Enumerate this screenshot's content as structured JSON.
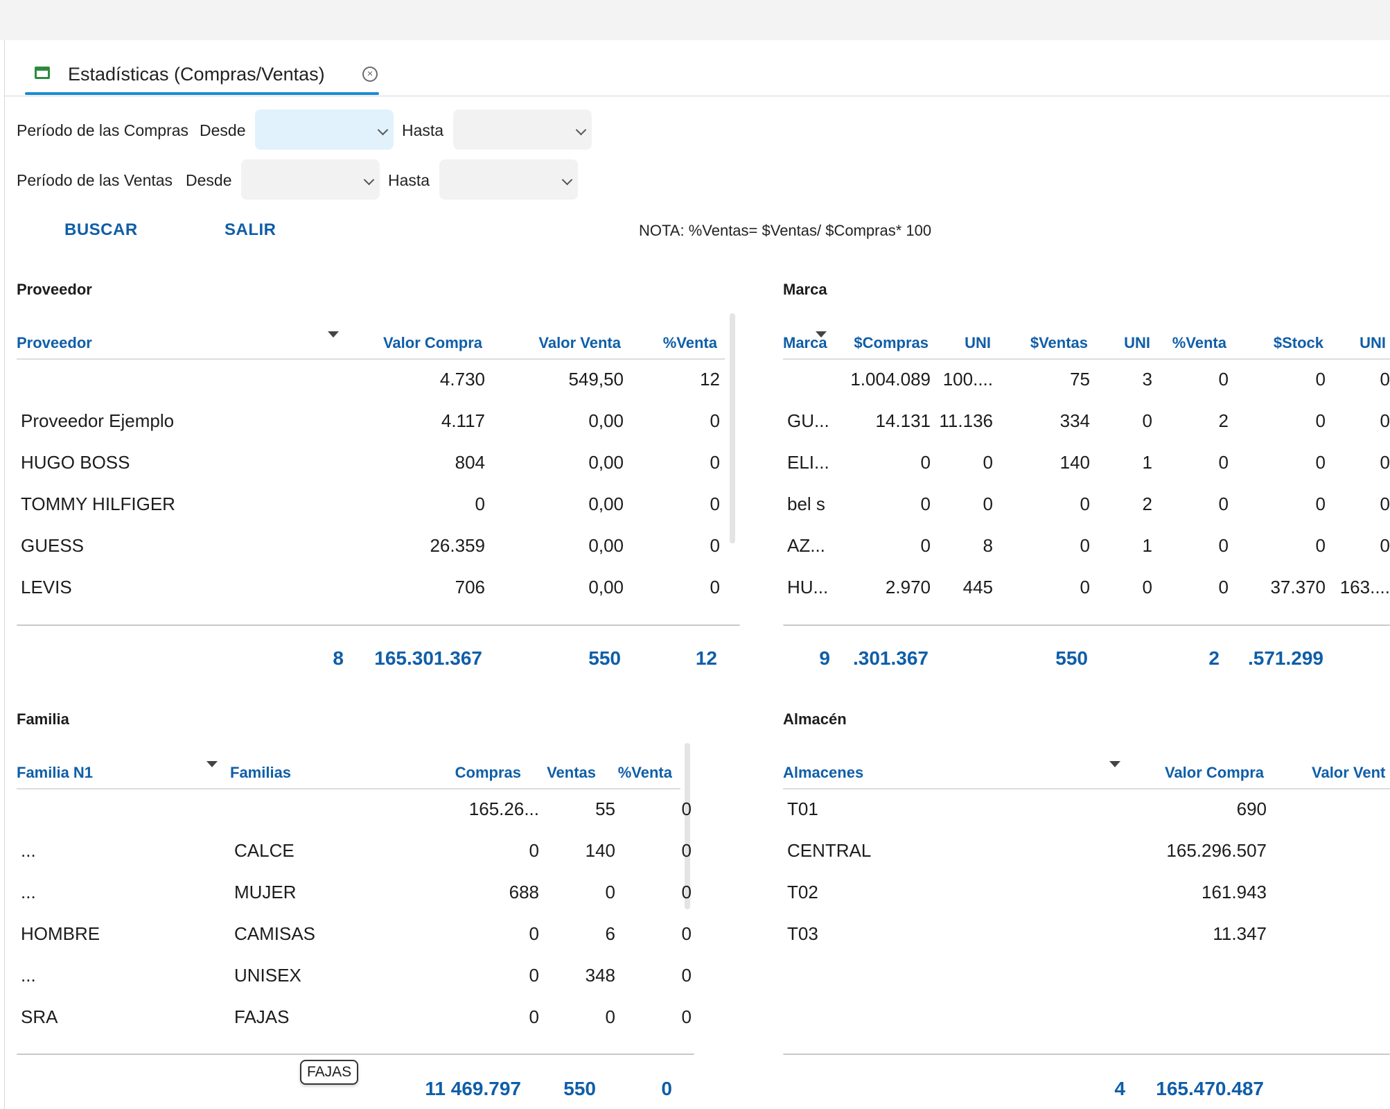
{
  "tab": {
    "title": "Estadísticas (Compras/Ventas)"
  },
  "filters": {
    "compras_label": "Período de las Compras",
    "ventas_label": "Período de las Ventas",
    "desde": "Desde",
    "hasta": "Hasta"
  },
  "actions": {
    "buscar": "BUSCAR",
    "salir": "SALIR"
  },
  "note": "NOTA:  %Ventas= $Ventas/ $Compras* 100",
  "proveedor": {
    "title": "Proveedor",
    "headers": [
      "Proveedor",
      "Valor Compra",
      "Valor Venta",
      "%Venta"
    ],
    "rows": [
      [
        "",
        "4.730",
        "549,50",
        "12"
      ],
      [
        "Proveedor Ejemplo",
        "4.117",
        "0,00",
        "0"
      ],
      [
        "HUGO BOSS",
        "804",
        "0,00",
        "0"
      ],
      [
        "TOMMY HILFIGER",
        "0",
        "0,00",
        "0"
      ],
      [
        "GUESS",
        "26.359",
        "0,00",
        "0"
      ],
      [
        "LEVIS",
        "706",
        "0,00",
        "0"
      ]
    ],
    "totals": [
      "8",
      "165.301.367",
      "550",
      "12"
    ]
  },
  "marca": {
    "title": "Marca",
    "headers": [
      "Marca",
      "$Compras",
      "UNI",
      "$Ventas",
      "UNI",
      "%Venta",
      "$Stock",
      "UNI"
    ],
    "rows": [
      [
        "",
        "1.004.089",
        "100....",
        "75",
        "3",
        "0",
        "0",
        "0"
      ],
      [
        "GU...",
        "14.131",
        "11.136",
        "334",
        "0",
        "2",
        "0",
        "0"
      ],
      [
        "ELI...",
        "0",
        "0",
        "140",
        "1",
        "0",
        "0",
        "0"
      ],
      [
        "bel s",
        "0",
        "0",
        "0",
        "2",
        "0",
        "0",
        "0"
      ],
      [
        "AZ...",
        "0",
        "8",
        "0",
        "1",
        "0",
        "0",
        "0"
      ],
      [
        "HU...",
        "2.970",
        "445",
        "0",
        "0",
        "0",
        "37.370",
        "163...."
      ]
    ],
    "totals": [
      "9",
      ".301.367",
      "550",
      "2",
      ".571.299"
    ]
  },
  "familia": {
    "title": "Familia",
    "headers": [
      "Familia N1",
      "Familias",
      "Compras",
      "Ventas",
      "%Venta"
    ],
    "rows": [
      [
        "",
        "",
        "165.26...",
        "55",
        "0"
      ],
      [
        "...",
        "CALCE",
        "0",
        "140",
        "0"
      ],
      [
        "...",
        "MUJER",
        "688",
        "0",
        "0"
      ],
      [
        "HOMBRE",
        "CAMISAS",
        "0",
        "6",
        "0"
      ],
      [
        "...",
        "UNISEX",
        "0",
        "348",
        "0"
      ],
      [
        "SRA",
        "FAJAS",
        "0",
        "0",
        "0"
      ]
    ],
    "totals": [
      "11 469.797",
      "550",
      "0"
    ],
    "tooltip": "FAJAS"
  },
  "almacen": {
    "title": "Almacén",
    "headers": [
      "Almacenes",
      "Valor Compra",
      "Valor Vent"
    ],
    "rows": [
      [
        "T01",
        "690"
      ],
      [
        "CENTRAL",
        "165.296.507"
      ],
      [
        "T02",
        "161.943"
      ],
      [
        "T03",
        "11.347"
      ]
    ],
    "totals": [
      "4",
      "165.470.487"
    ]
  }
}
